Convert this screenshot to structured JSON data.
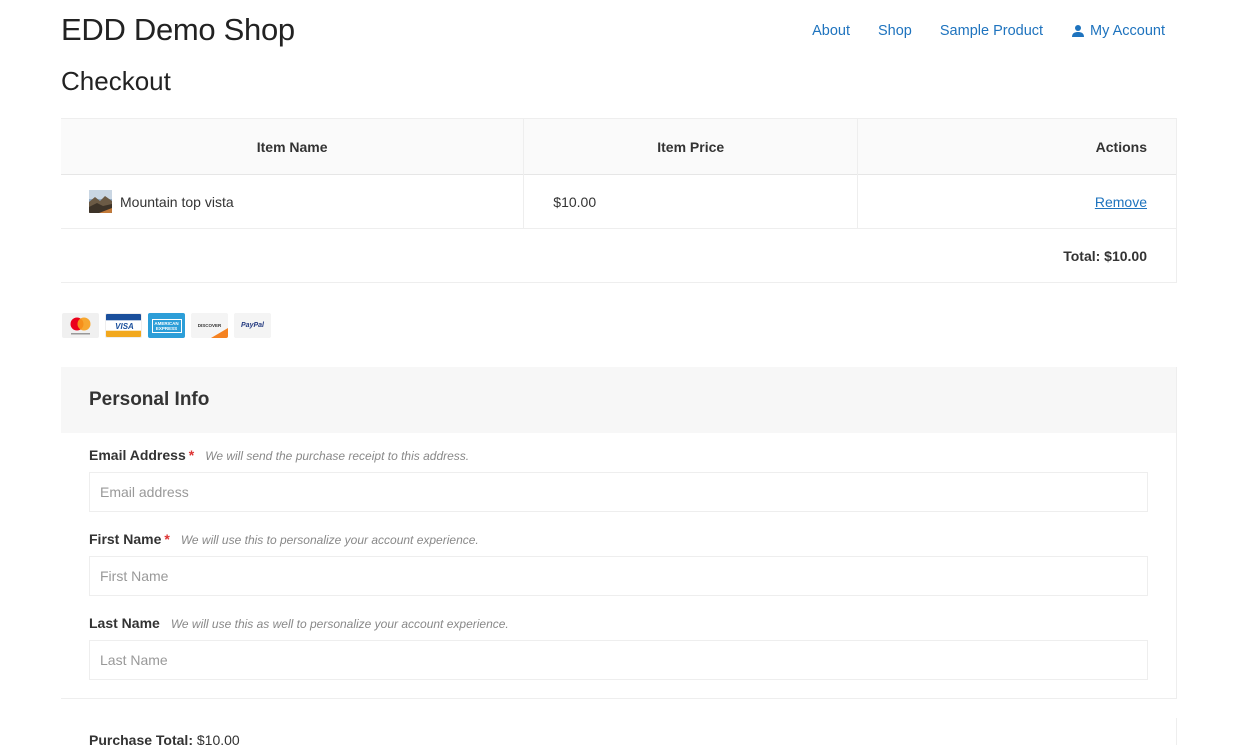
{
  "header": {
    "site_title": "EDD Demo Shop",
    "nav": {
      "about": "About",
      "shop": "Shop",
      "sample_product": "Sample Product",
      "my_account": "My Account"
    }
  },
  "page": {
    "title": "Checkout"
  },
  "cart": {
    "columns": {
      "name": "Item Name",
      "price": "Item Price",
      "actions": "Actions"
    },
    "items": [
      {
        "name": "Mountain top vista",
        "price": "$10.00",
        "action": "Remove"
      }
    ],
    "total": "Total: $10.00"
  },
  "payment_icons": [
    "mastercard-icon",
    "visa-icon",
    "amex-icon",
    "discover-icon",
    "paypal-icon"
  ],
  "payment_labels": {
    "visa": "VISA",
    "amex": "AMERICAN EXPRESS",
    "discover": "DISCOVER",
    "paypal": "PayPal"
  },
  "personal_info": {
    "heading": "Personal Info",
    "email": {
      "label": "Email Address",
      "required": "*",
      "description": "We will send the purchase receipt to this address.",
      "placeholder": "Email address",
      "value": ""
    },
    "first_name": {
      "label": "First Name",
      "required": "*",
      "description": "We will use this to personalize your account experience.",
      "placeholder": "First Name",
      "value": ""
    },
    "last_name": {
      "label": "Last Name",
      "description": "We will use this as well to personalize your account experience.",
      "placeholder": "Last Name",
      "value": ""
    }
  },
  "purchase": {
    "label": "Purchase Total:",
    "amount": "$10.00"
  },
  "colors": {
    "link": "#1e73be",
    "required": "#dd3333",
    "panel_bg": "#f7f7f7"
  }
}
